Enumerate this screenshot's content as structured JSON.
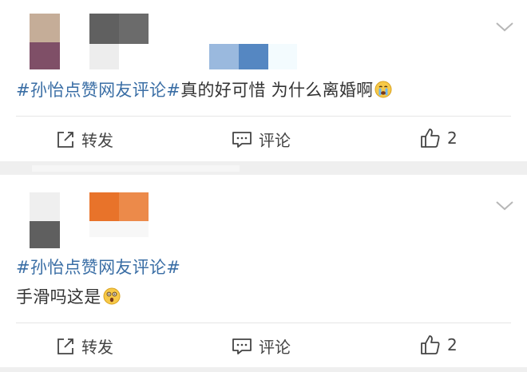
{
  "posts": [
    {
      "topic": "#孙怡点赞网友评论#",
      "text": "真的好可惜 为什么离婚啊",
      "emoji": "crying-face-icon",
      "actions": {
        "repost": "转发",
        "comment": "评论",
        "like_count": "2"
      }
    },
    {
      "topic": "#孙怡点赞网友评论#",
      "text": "手滑吗这是",
      "emoji": "astonished-face-icon",
      "actions": {
        "repost": "转发",
        "comment": "评论",
        "like_count": "2"
      }
    }
  ],
  "colors": {
    "topic": "#3a6ea5",
    "text": "#333333",
    "separator": "#efefef"
  }
}
